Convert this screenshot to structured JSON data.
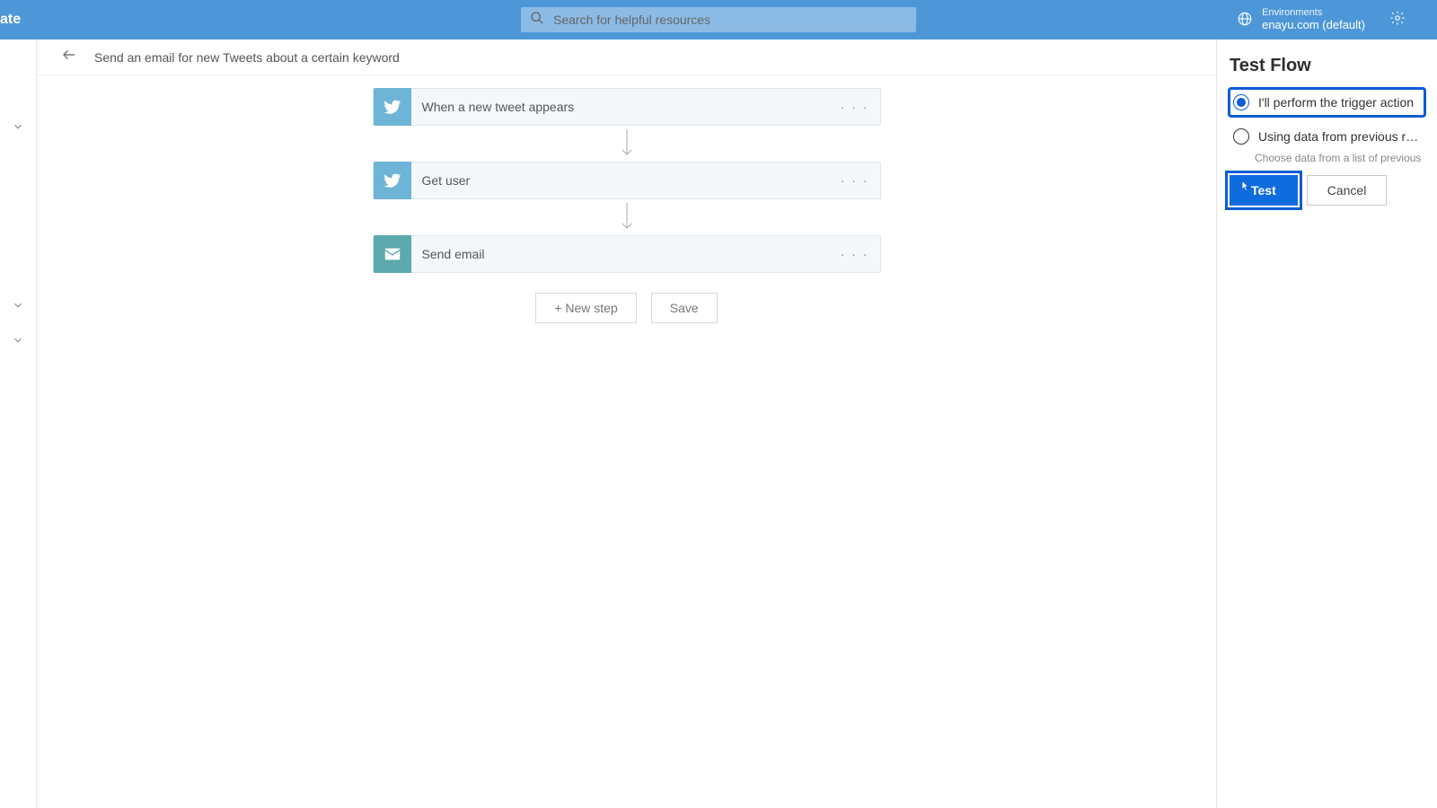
{
  "header": {
    "title_fragment": "ate",
    "search_placeholder": "Search for helpful resources",
    "env_label": "Environments",
    "env_name": "enayu.com (default)"
  },
  "breadcrumb": {
    "flow_name": "Send an email for new Tweets about a certain keyword"
  },
  "steps": [
    {
      "title": "When a new tweet appears",
      "icon": "twitter"
    },
    {
      "title": "Get user",
      "icon": "twitter"
    },
    {
      "title": "Send email",
      "icon": "mail"
    }
  ],
  "canvas_actions": {
    "new_step": "+ New step",
    "save": "Save"
  },
  "test_panel": {
    "title": "Test Flow",
    "options": [
      {
        "label": "I'll perform the trigger action",
        "checked": true
      },
      {
        "label": "Using data from previous runs",
        "checked": false,
        "sub": "Choose data from a list of previous runs"
      }
    ],
    "test": "Test",
    "cancel": "Cancel"
  }
}
